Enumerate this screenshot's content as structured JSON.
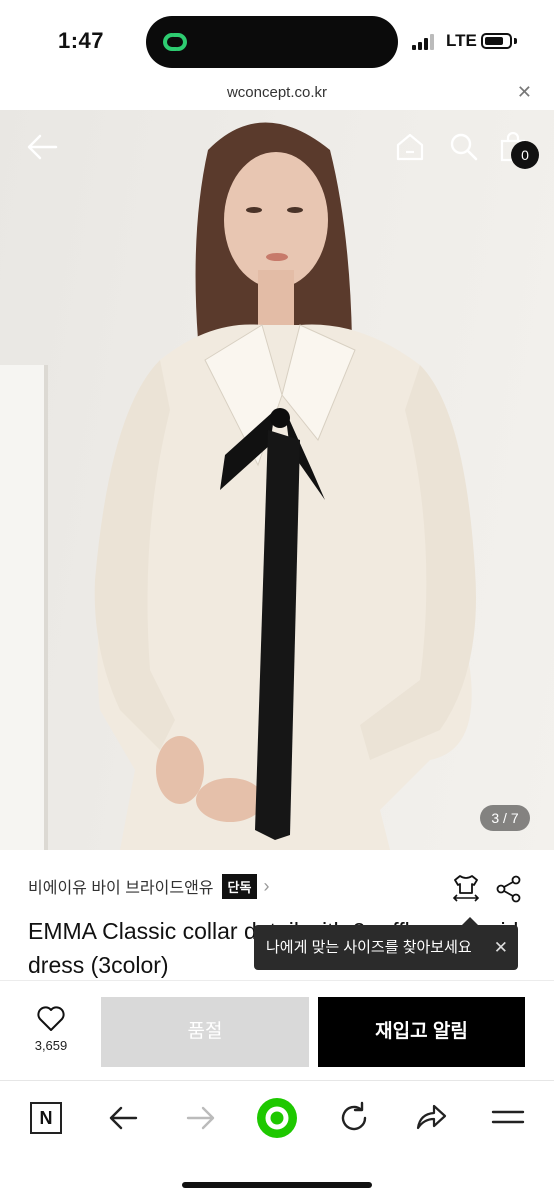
{
  "status_bar": {
    "time": "1:47",
    "network": "LTE",
    "signal_icon": "signal-bars-icon",
    "battery_icon": "battery-icon",
    "island_app_icon": "link-logo-icon"
  },
  "browser": {
    "url": "wconcept.co.kr",
    "close_icon": "close-icon"
  },
  "header": {
    "back_icon": "arrow-left-icon",
    "home_icon": "home-icon",
    "search_icon": "search-icon",
    "cart_icon": "shopping-bag-icon",
    "cart_count": "0"
  },
  "gallery": {
    "counter": "3 / 7"
  },
  "product": {
    "brand": "비에이유 바이 브라이드앤유",
    "exclusive_label": "단독",
    "brand_chevron": "›",
    "title": "EMMA Classic collar detail with 2 ruffle mermaid dress (3color)",
    "size_icon": "size-guide-icon",
    "share_icon": "share-icon"
  },
  "tooltip": {
    "text": "나에게 맞는 사이즈를 찾아보세요",
    "close": "✕"
  },
  "actions": {
    "like_count": "3,659",
    "soldout_label": "품절",
    "restock_label": "재입고 알림"
  },
  "toolbar": {
    "n_label": "N",
    "items": [
      "naver-icon",
      "back-icon",
      "forward-icon",
      "green-home-icon",
      "reload-icon",
      "share-icon",
      "menu-icon"
    ]
  },
  "colors": {
    "accent_green": "#1ec800",
    "badge_black": "#111111",
    "soldout_gray": "#d9d9d9"
  }
}
